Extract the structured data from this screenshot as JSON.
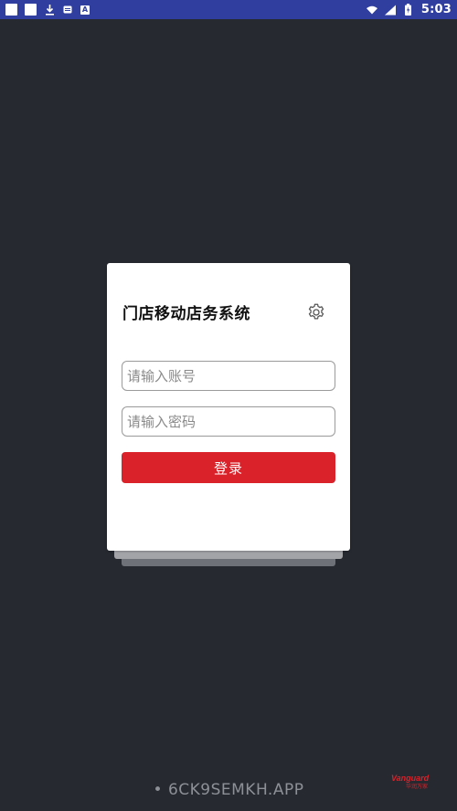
{
  "status_bar": {
    "time": "5:03",
    "icons": [
      "notification-square-icon",
      "notification-square-icon",
      "download-icon",
      "sd-card-icon",
      "a-badge-icon",
      "wifi-icon",
      "signal-icon",
      "battery-icon"
    ],
    "a_badge": "A",
    "colors": {
      "background": "#303f9f"
    }
  },
  "login_card": {
    "title": "门店移动店务系统",
    "account_placeholder": "请输入账号",
    "password_placeholder": "请输入密码",
    "login_label": "登录",
    "colors": {
      "button": "#d9222a",
      "card": "#ffffff",
      "page_bg": "#262930"
    }
  },
  "footer": {
    "code_text": "• 6CK9SEMKH.APP",
    "brand_name": "Vanguard",
    "brand_sub": "华润万家"
  }
}
